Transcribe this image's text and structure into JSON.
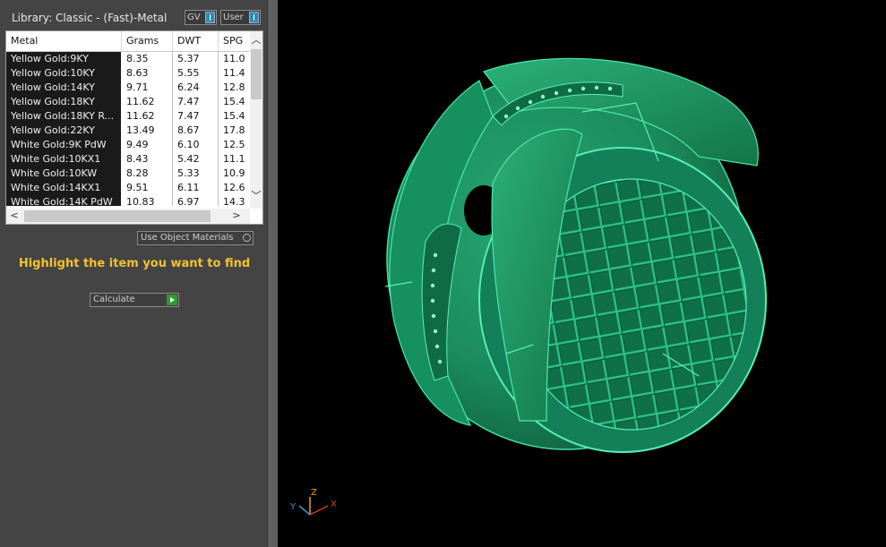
{
  "panel": {
    "title": "Library: Classic - (Fast)-Metal",
    "gv_label": "GV",
    "user_label": "User",
    "columns": [
      "Metal",
      "Grams",
      "DWT",
      "SPG"
    ],
    "rows": [
      [
        "Yellow Gold:9KY",
        "8.35",
        "5.37",
        "11.0"
      ],
      [
        "Yellow Gold:10KY",
        "8.63",
        "5.55",
        "11.4"
      ],
      [
        "Yellow Gold:14KY",
        "9.71",
        "6.24",
        "12.8"
      ],
      [
        "Yellow Gold:18KY",
        "11.62",
        "7.47",
        "15.4"
      ],
      [
        "Yellow Gold:18KY R...",
        "11.62",
        "7.47",
        "15.4"
      ],
      [
        "Yellow Gold:22KY",
        "13.49",
        "8.67",
        "17.8"
      ],
      [
        "White Gold:9K PdW",
        "9.49",
        "6.10",
        "12.5"
      ],
      [
        "White Gold:10KX1",
        "8.43",
        "5.42",
        "11.1"
      ],
      [
        "White Gold:10KW",
        "8.28",
        "5.33",
        "10.9"
      ],
      [
        "White Gold:14KX1",
        "9.51",
        "6.11",
        "12.6"
      ],
      [
        "White Gold:14K PdW",
        "10.83",
        "6.97",
        "14.3"
      ]
    ],
    "use_object_materials": "Use Object Materials",
    "find_message": "Highlight the item you want to find",
    "calculate_label": "Calculate"
  },
  "viewport": {
    "axis_labels": {
      "z": "Z",
      "y": "Y",
      "x": "X"
    },
    "model_color": "#1f8f5f",
    "background": "#000000"
  }
}
